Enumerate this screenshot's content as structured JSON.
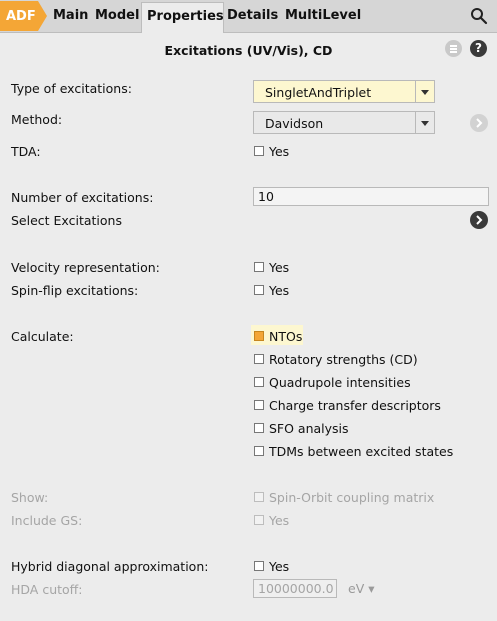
{
  "tabs": {
    "adf": "ADF",
    "main": "Main",
    "model": "Model",
    "properties": "Properties",
    "details": "Details",
    "multilevel": "MultiLevel"
  },
  "panel_title": "Excitations (UV/Vis), CD",
  "help_label": "?",
  "colors": {
    "accent": "#f4a636",
    "field_highlight": "#fdf7d0",
    "background": "#ececec",
    "disabled_text": "#a5a5a5"
  },
  "fields": {
    "type_label": "Type of excitations:",
    "type_value": "SingletAndTriplet",
    "method_label": "Method:",
    "method_value": "Davidson",
    "tda_label": "TDA:",
    "tda_opt": "Yes",
    "num_label": "Number of excitations:",
    "num_value": "10",
    "select_excitations": "Select Excitations",
    "velocity_label": "Velocity representation:",
    "velocity_opt": "Yes",
    "spinflip_label": "Spin-flip excitations:",
    "spinflip_opt": "Yes",
    "calculate_label": "Calculate:",
    "calc_options": [
      {
        "label": "NTOs",
        "checked": true
      },
      {
        "label": "Rotatory strengths (CD)",
        "checked": false
      },
      {
        "label": "Quadrupole intensities",
        "checked": false
      },
      {
        "label": "Charge transfer descriptors",
        "checked": false
      },
      {
        "label": "SFO analysis",
        "checked": false
      },
      {
        "label": "TDMs between excited states",
        "checked": false
      }
    ],
    "show_label": "Show:",
    "show_opt": "Spin-Orbit coupling matrix",
    "includegs_label": "Include GS:",
    "includegs_opt": "Yes",
    "hda_label": "Hybrid diagonal approximation:",
    "hda_opt": "Yes",
    "hda_cutoff_label": "HDA cutoff:",
    "hda_cutoff_value": "10000000.0",
    "hda_unit": "eV ▾"
  }
}
